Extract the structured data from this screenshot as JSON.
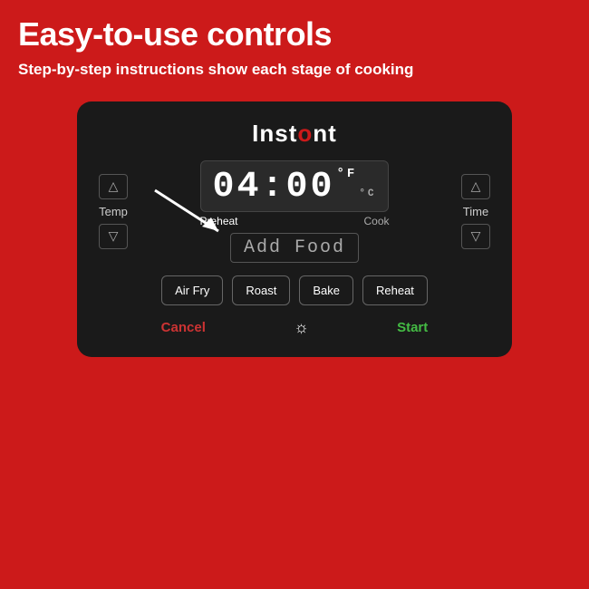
{
  "header": {
    "title": "Easy-to-use controls",
    "subtitle": "Step-by-step instructions show each stage of cooking"
  },
  "device": {
    "logo": "Instant",
    "time_display": "04:00",
    "temp_unit": "°F",
    "temp_subunit": "°C",
    "stage_preheat": "Preheat",
    "stage_cook": "Cook",
    "add_food": "Add Food",
    "temp_label": "Temp",
    "time_label": "Time",
    "modes": [
      "Air Fry",
      "Roast",
      "Bake",
      "Reheat"
    ],
    "cancel_label": "Cancel",
    "start_label": "Start",
    "light_icon": "☼"
  }
}
